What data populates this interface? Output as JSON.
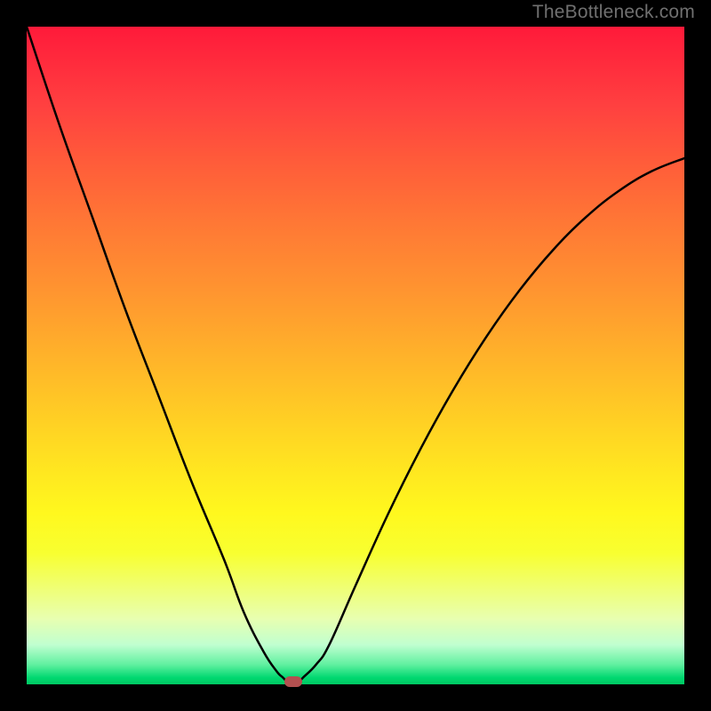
{
  "attribution": "TheBottleneck.com",
  "chart_data": {
    "type": "line",
    "title": "",
    "xlabel": "",
    "ylabel": "",
    "xlim": [
      0,
      100
    ],
    "ylim": [
      0,
      100
    ],
    "series": [
      {
        "name": "bottleneck-curve",
        "x": [
          0,
          5,
          10,
          15,
          20,
          25,
          30,
          33,
          36,
          38,
          39,
          40,
          41,
          42,
          44,
          46,
          50,
          55,
          60,
          65,
          70,
          75,
          80,
          85,
          90,
          95,
          100
        ],
        "y": [
          100,
          85,
          71,
          57,
          44,
          31,
          19,
          11,
          5,
          2,
          1,
          0,
          0,
          1,
          3,
          6,
          15,
          26,
          36,
          45,
          53,
          60,
          66,
          71,
          75,
          78,
          80
        ]
      }
    ],
    "marker": {
      "x": 40.5,
      "y": 0
    },
    "gradient_stops": [
      {
        "pct": 0,
        "color": "#ff1a3a"
      },
      {
        "pct": 50,
        "color": "#ffb22a"
      },
      {
        "pct": 74,
        "color": "#fff81e"
      },
      {
        "pct": 100,
        "color": "#00c862"
      }
    ]
  }
}
